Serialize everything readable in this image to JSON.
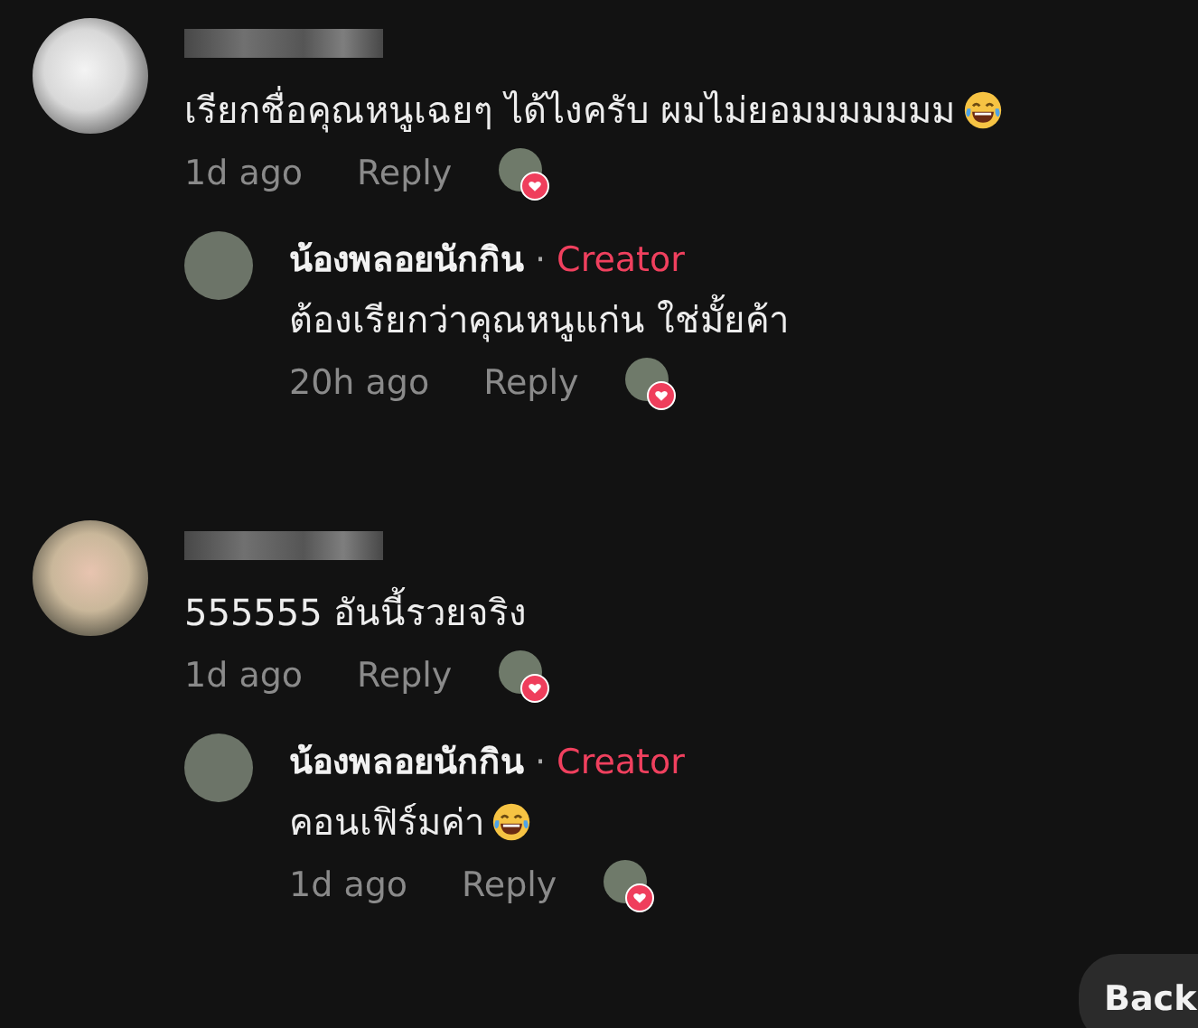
{
  "comments": [
    {
      "text": "เรียกชื่อคุณหนูเฉยๆ ได้ไงครับ ผมไม่ยอมมมมมมม",
      "laugh_emoji": true,
      "time": "1d ago",
      "reply_label": "Reply",
      "liked_by_creator": true,
      "replies": [
        {
          "author": "น้องพลอยนักกิน",
          "separator": "·",
          "badge": "Creator",
          "text": "ต้องเรียกว่าคุณหนูแก่น ใช่มั้ยค้า",
          "laugh_emoji": false,
          "time": "20h ago",
          "reply_label": "Reply",
          "liked_by_creator": true
        }
      ]
    },
    {
      "text": "555555 อันนี้รวยจริง",
      "laugh_emoji": false,
      "time": "1d ago",
      "reply_label": "Reply",
      "liked_by_creator": true,
      "replies": [
        {
          "author": "น้องพลอยนักกิน",
          "separator": "·",
          "badge": "Creator",
          "text": "คอนเฟิร์มค่า",
          "laugh_emoji": true,
          "time": "1d ago",
          "reply_label": "Reply",
          "liked_by_creator": true
        }
      ]
    }
  ],
  "back_button": {
    "label": "Back"
  }
}
